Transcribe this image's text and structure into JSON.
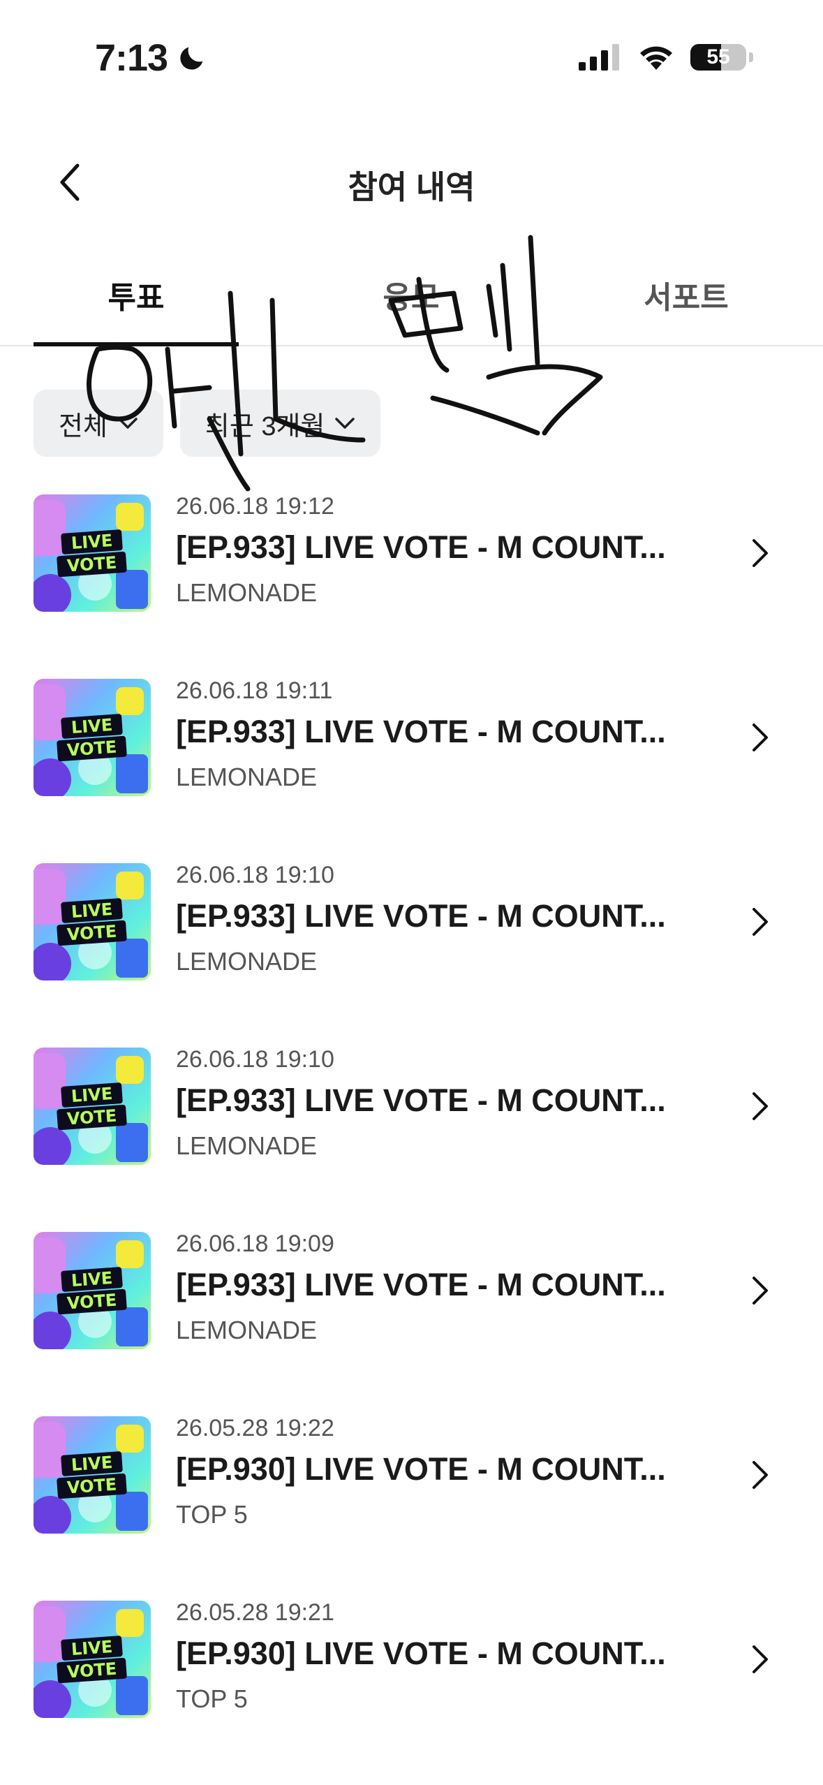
{
  "status_bar": {
    "time": "7:13",
    "battery_level": "55",
    "battery_fraction": 0.55,
    "icons": [
      "moon-icon",
      "signal-icon",
      "wifi-icon",
      "battery-icon"
    ]
  },
  "header": {
    "title": "참여 내역",
    "back_icon": "chevron-left-icon"
  },
  "tabs": [
    {
      "label": "투표",
      "active": true
    },
    {
      "label": "응모",
      "active": false
    },
    {
      "label": "서포트",
      "active": false
    }
  ],
  "filters": {
    "type_label": "전체",
    "period_label": "최근 3개월"
  },
  "thumbnail": {
    "line1": "LIVE",
    "line2": "VOTE"
  },
  "votes": [
    {
      "date": "26.06.18 19:12",
      "title": "[EP.933] LIVE VOTE - M COUNT...",
      "subtitle": "LEMONADE"
    },
    {
      "date": "26.06.18 19:11",
      "title": "[EP.933] LIVE VOTE - M COUNT...",
      "subtitle": "LEMONADE"
    },
    {
      "date": "26.06.18 19:10",
      "title": "[EP.933] LIVE VOTE - M COUNT...",
      "subtitle": "LEMONADE"
    },
    {
      "date": "26.06.18 19:10",
      "title": "[EP.933] LIVE VOTE - M COUNT...",
      "subtitle": "LEMONADE"
    },
    {
      "date": "26.06.18 19:09",
      "title": "[EP.933] LIVE VOTE - M COUNT...",
      "subtitle": "LEMONADE"
    },
    {
      "date": "26.05.28 19:22",
      "title": "[EP.930] LIVE VOTE - M COUNT...",
      "subtitle": "TOP 5"
    },
    {
      "date": "26.05.28 19:21",
      "title": "[EP.930] LIVE VOTE - M COUNT...",
      "subtitle": "TOP 5"
    }
  ],
  "colors": {
    "tab_underline": "#111111",
    "chip_background": "#eeeff1",
    "divider": "#e6e6e6"
  }
}
